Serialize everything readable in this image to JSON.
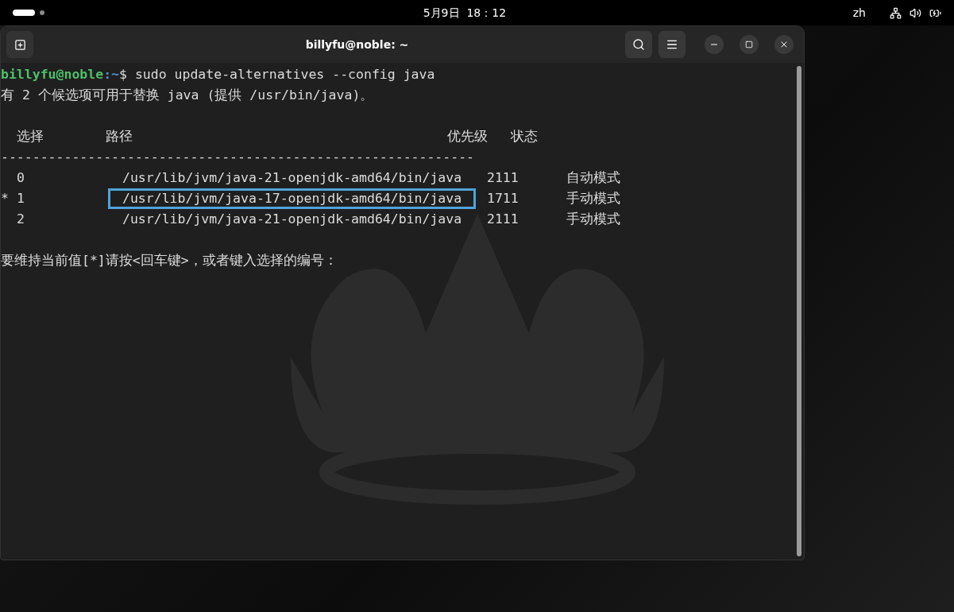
{
  "topbar": {
    "clock": "5月9日  18：12",
    "language": "zh"
  },
  "window": {
    "title": "billyfu@noble: ~"
  },
  "terminal": {
    "prompt_user": "billyfu@noble",
    "prompt_path": ":~",
    "prompt_symbol": "$",
    "command": " sudo update-alternatives --config java",
    "info": "有 2 个候选项可用于替换 java (提供 /usr/bin/java)。",
    "headers": [
      "选择",
      "路径",
      "优先级",
      "状态"
    ],
    "separator": "------------------------------------------------------------",
    "rows": [
      {
        "marker": "",
        "number": "0",
        "path": "/usr/lib/jvm/java-21-openjdk-amd64/bin/java",
        "priority": "2111",
        "status": "自动模式",
        "highlighted": false
      },
      {
        "marker": "*",
        "number": "1",
        "path": "/usr/lib/jvm/java-17-openjdk-amd64/bin/java",
        "priority": "1711",
        "status": "手动模式",
        "highlighted": true
      },
      {
        "marker": "",
        "number": "2",
        "path": "/usr/lib/jvm/java-21-openjdk-amd64/bin/java",
        "priority": "2111",
        "status": "手动模式",
        "highlighted": false
      }
    ],
    "question": "要维持当前值[*]请按<回车键>，或者键入选择的编号："
  }
}
